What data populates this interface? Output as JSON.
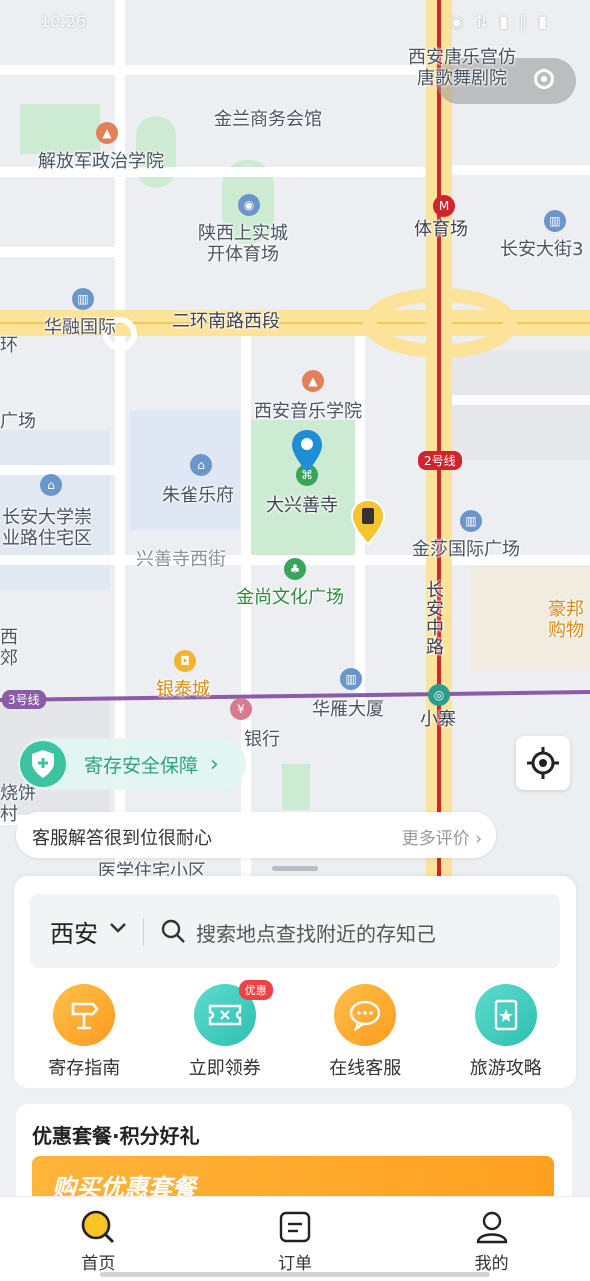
{
  "status_bar": {
    "time": "10:26",
    "icons": "◉ ⇅ ▮ ‖ ▮"
  },
  "map": {
    "labels": {
      "tanglegong": "西安唐乐宫仿\n唐歌舞剧院",
      "jinlan": "金兰商务会馆",
      "jiefangjun": "解放军政治学院",
      "shaanxi_stadium": "陕西上实城\n开体育场",
      "tiyuchang": "体育场",
      "changan_street": "长安大街3",
      "huarong": "华融国际",
      "erhuan": "二环南路西段",
      "huan": "环",
      "guangchang_left": "广场",
      "conservatory": "西安音乐学院",
      "zhuque": "朱雀乐府",
      "daxingshan": "大兴善寺",
      "changan_univ": "长安大学崇\n业路住宅区",
      "xingshansi_street": "兴善寺西街",
      "jinsha": "金莎国际广场",
      "jinshang": "金尚文化广场",
      "changan_middle": "长\n安\n中\n路",
      "haobang": "豪邦\n购物",
      "xi_jiao": "西\n郊",
      "yintai": "银泰城",
      "huayan": "华雁大厦",
      "xiaozhai": "小寨",
      "bank": "银行",
      "shaobing": "烧饼\n村",
      "yixue": "医学住宅小区",
      "line2": "2号线",
      "line3": "3号线"
    }
  },
  "safety_banner": {
    "label": "寄存安全保障",
    "arrow": "›"
  },
  "review_bar": {
    "text": "客服解答很到位很耐心",
    "more": "更多评价 ›"
  },
  "search": {
    "city": "西安",
    "placeholder": "搜索地点查找附近的存知己"
  },
  "quick_actions": [
    {
      "label": "寄存指南",
      "icon": "signpost-icon",
      "color": "#ffa52a"
    },
    {
      "label": "立即领券",
      "icon": "ticket-icon",
      "color": "#3cc9b8",
      "tag": "优惠"
    },
    {
      "label": "在线客服",
      "icon": "chat-icon",
      "color": "#ffa52a"
    },
    {
      "label": "旅游攻略",
      "icon": "guidebook-icon",
      "color": "#3cc9b8"
    }
  ],
  "promo": {
    "heading": "优惠套餐·积分好礼",
    "banner_text": "购买优惠套餐"
  },
  "tabbar": [
    {
      "label": "首页",
      "icon": "home-search-icon",
      "active": true
    },
    {
      "label": "订单",
      "icon": "order-icon",
      "active": false
    },
    {
      "label": "我的",
      "icon": "profile-icon",
      "active": false
    }
  ]
}
